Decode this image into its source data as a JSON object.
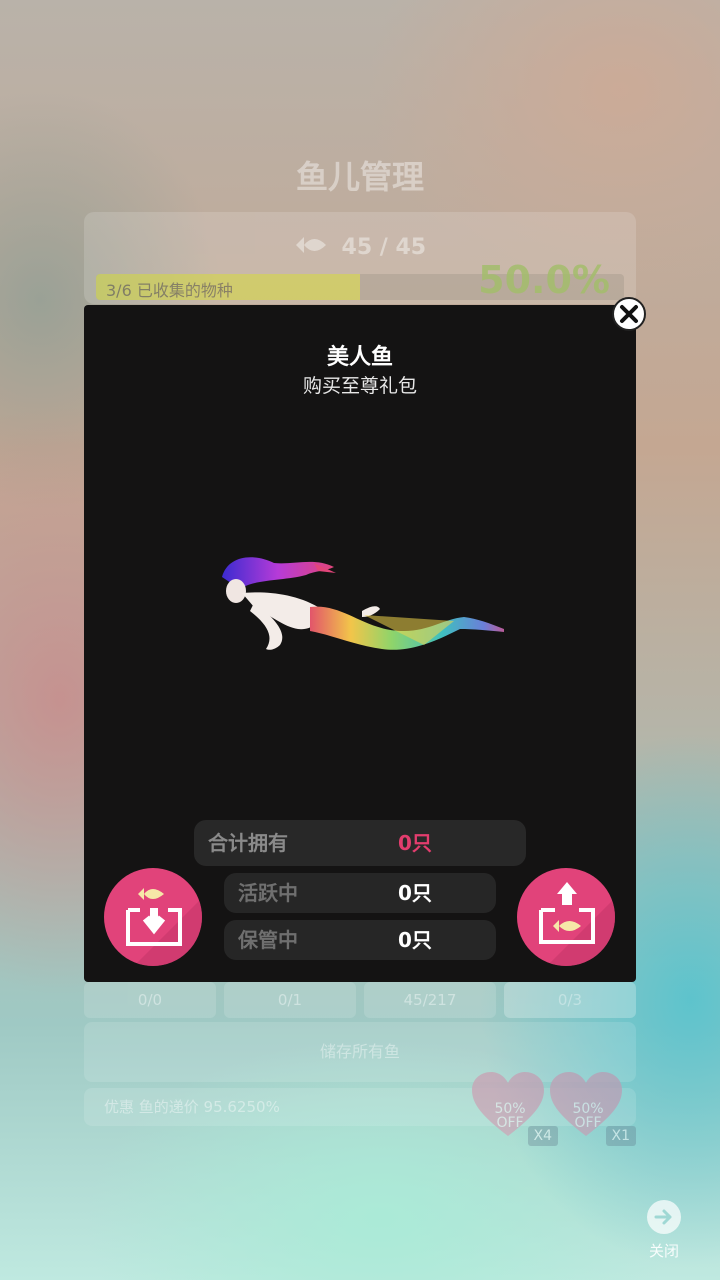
{
  "background": {
    "title": "鱼儿管理",
    "fish_count": "45 / 45",
    "progress": {
      "label": "3/6 已收集的物种",
      "fraction": 0.5,
      "percent_text": "50.0%"
    },
    "tabs": [
      {
        "value": "0/0"
      },
      {
        "value": "0/1"
      },
      {
        "value": "45/217"
      },
      {
        "value": "0/3"
      }
    ],
    "store_all_label": "储存所有鱼",
    "upgrade_text": "优惠 鱼的递价 95.6250%",
    "offers": [
      {
        "discount": "50%",
        "off": "OFF",
        "multiplier": "X4"
      },
      {
        "discount": "50%",
        "off": "OFF",
        "multiplier": "X1"
      }
    ],
    "close_label": "关闭"
  },
  "popup": {
    "title": "美人鱼",
    "subtitle": "购买至尊礼包",
    "stats": {
      "total_label": "合计拥有",
      "total_value": "0只",
      "active_label": "活跃中",
      "active_value": "0只",
      "storage_label": "保管中",
      "storage_value": "0只"
    },
    "colors": {
      "accent_pink": "#e1437a",
      "total_value_color": "#e33d6e",
      "popup_bg": "#141313"
    }
  }
}
